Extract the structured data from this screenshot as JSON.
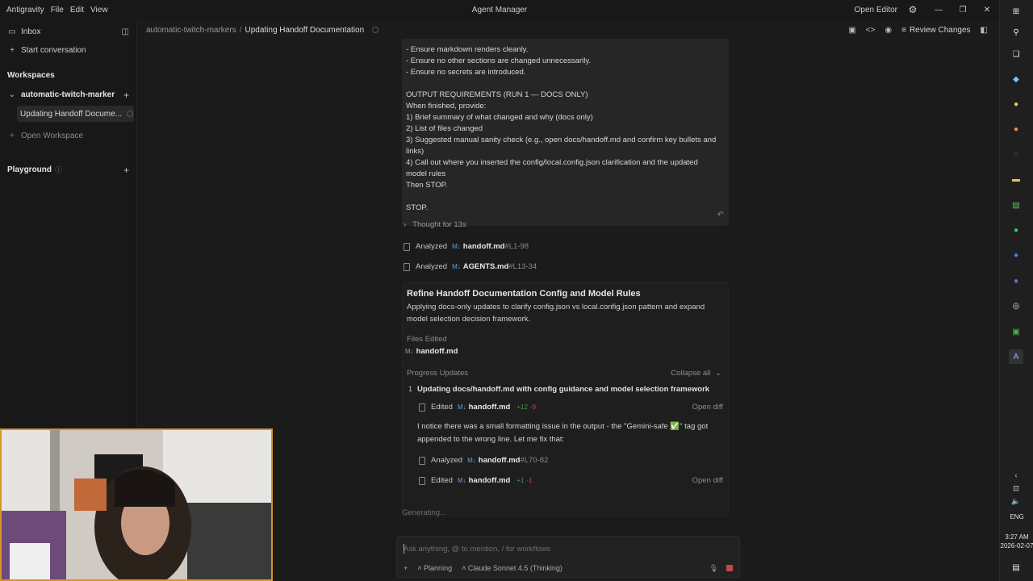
{
  "menu": [
    "Antigravity",
    "File",
    "Edit",
    "View"
  ],
  "window_title": "Agent Manager",
  "open_editor": "Open Editor",
  "sidebar": {
    "inbox": "Inbox",
    "start_conversation": "Start conversation",
    "workspaces_heading": "Workspaces",
    "workspace_name": "automatic-twitch-marker",
    "active_conversation": "Updating Handoff Docume...",
    "open_workspace": "Open Workspace",
    "playground": "Playground"
  },
  "breadcrumb": {
    "workspace": "automatic-twitch-markers",
    "separator": "/",
    "current": "Updating Handoff Documentation"
  },
  "toolbar": {
    "review_changes": "Review Changes"
  },
  "prompt_lines": [
    "- Ensure markdown renders cleanly.",
    "- Ensure no other sections are changed unnecessarily.",
    "- Ensure no secrets are introduced.",
    "",
    "OUTPUT REQUIREMENTS (RUN 1 — DOCS ONLY)",
    "When finished, provide:",
    "1) Brief summary of what changed and why (docs only)",
    "2) List of files changed",
    "3) Suggested manual sanity check (e.g., open docs/handoff.md and confirm key bullets and",
    "links)",
    "4) Call out where you inserted the config/local.config.json clarification and the updated",
    "model rules",
    "Then STOP.",
    "",
    "STOP."
  ],
  "thought": "Thought for 13s",
  "activities": [
    {
      "verb": "Analyzed",
      "file": "handoff.md",
      "range": "#L1-98"
    },
    {
      "verb": "Analyzed",
      "file": "AGENTS.md",
      "range": "#L13-34"
    }
  ],
  "task": {
    "title": "Refine Handoff Documentation Config and Model Rules",
    "description": "Applying docs-only updates to clarify config.json vs local.config.json pattern and expand model selection decision framework.",
    "files_edited_label": "Files Edited",
    "files_edited": [
      "handoff.md"
    ],
    "progress_label": "Progress Updates",
    "collapse_all": "Collapse all",
    "step_number": "1",
    "step_title": "Updating docs/handoff.md with config guidance and model selection framework",
    "step_actions": [
      {
        "verb": "Edited",
        "file": "handoff.md",
        "adds": "+12",
        "dels": "-9",
        "open_diff": "Open diff"
      },
      {
        "verb": "Analyzed",
        "file": "handoff.md",
        "range": "#L70-82"
      },
      {
        "verb": "Edited",
        "file": "handoff.md",
        "adds": "+1",
        "dels": "-1",
        "open_diff": "Open diff"
      }
    ],
    "note": "I notice there was a small formatting issue in the output - the \"Gemini-safe ✅\" tag got appended to the wrong line. Let me fix that:"
  },
  "generating": "Generating...",
  "input": {
    "placeholder": "Ask anything, @ to mention, / for workflows",
    "mode": "Planning",
    "model": "Claude Sonnet 4.5 (Thinking)"
  },
  "taskbar": {
    "lang": "ENG",
    "time": "3:27 AM",
    "date": "2026-02-07"
  }
}
